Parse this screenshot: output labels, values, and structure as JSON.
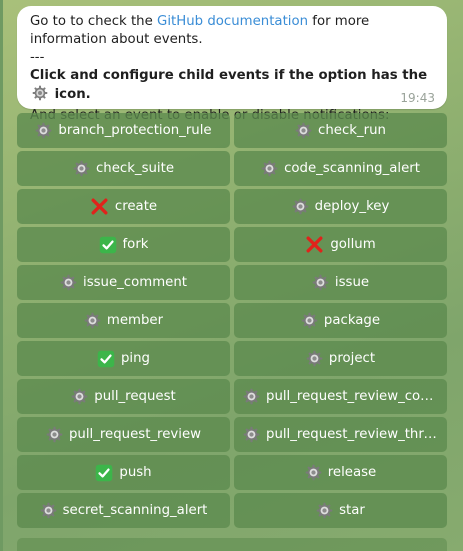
{
  "message": {
    "line1_prefix": "Go to to check the ",
    "link_text": "GitHub documentation",
    "line1_suffix": " for more information about events.",
    "separator": "---",
    "bold_prefix": "Click and configure child events if the option has the ",
    "bold_suffix": " icon.",
    "line_last": "And select an event to enable or disable notifications:",
    "time": "19:43"
  },
  "buttons": [
    {
      "label": "branch_protection_rule",
      "icon": "gear-icon"
    },
    {
      "label": "check_run",
      "icon": "gear-icon"
    },
    {
      "label": "check_suite",
      "icon": "gear-icon"
    },
    {
      "label": "code_scanning_alert",
      "icon": "gear-icon"
    },
    {
      "label": "create",
      "icon": "cross-mark-icon"
    },
    {
      "label": "deploy_key",
      "icon": "gear-icon"
    },
    {
      "label": "fork",
      "icon": "check-mark-icon"
    },
    {
      "label": "gollum",
      "icon": "cross-mark-icon"
    },
    {
      "label": "issue_comment",
      "icon": "gear-icon"
    },
    {
      "label": "issue",
      "icon": "gear-icon"
    },
    {
      "label": "member",
      "icon": "gear-icon"
    },
    {
      "label": "package",
      "icon": "gear-icon"
    },
    {
      "label": "ping",
      "icon": "check-mark-icon"
    },
    {
      "label": "project",
      "icon": "gear-icon"
    },
    {
      "label": "pull_request",
      "icon": "gear-icon"
    },
    {
      "label": "pull_request_review_com...",
      "icon": "gear-icon"
    },
    {
      "label": "pull_request_review",
      "icon": "gear-icon"
    },
    {
      "label": "pull_request_review_thre...",
      "icon": "gear-icon"
    },
    {
      "label": "push",
      "icon": "check-mark-icon"
    },
    {
      "label": "release",
      "icon": "gear-icon"
    },
    {
      "label": "secret_scanning_alert",
      "icon": "gear-icon"
    },
    {
      "label": "star",
      "icon": "gear-icon"
    }
  ],
  "colors": {
    "link": "#3a8dd6",
    "check": "#3cb54a",
    "cross": "#e0231b",
    "button_bg": "#5c8a4e"
  }
}
